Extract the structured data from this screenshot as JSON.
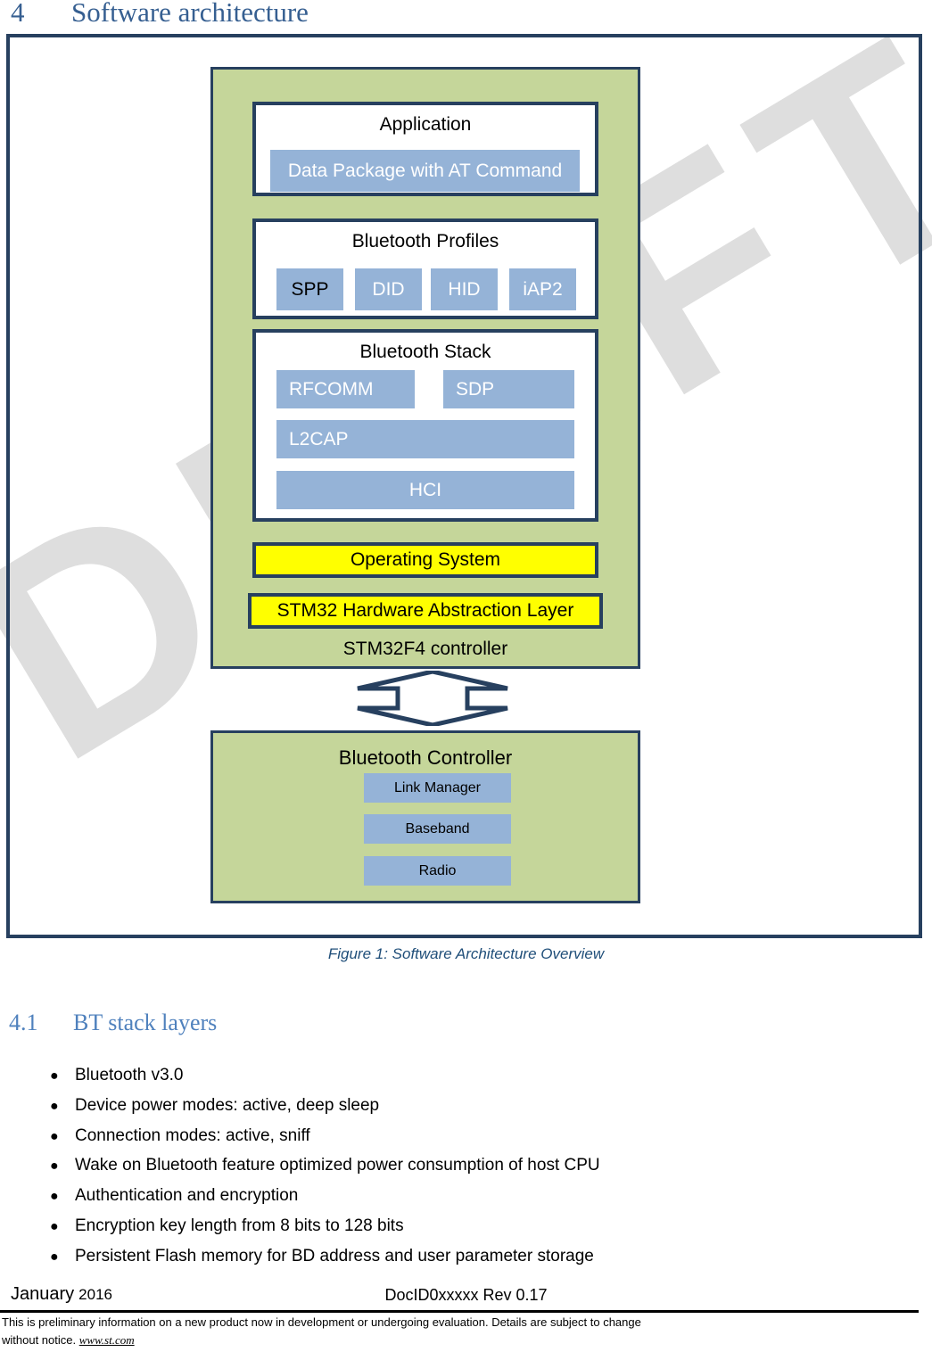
{
  "heading": {
    "number": "4",
    "title": "Software architecture"
  },
  "subheading": {
    "number": "4.1",
    "title": "BT stack layers"
  },
  "watermark": {
    "text": "DRAFT"
  },
  "figure": {
    "caption": "Figure 1: Software Architecture Overview",
    "host": {
      "footer_label": "STM32F4 controller",
      "application": {
        "title": "Application",
        "chip": "Data Package with AT Command"
      },
      "profiles": {
        "title": "Bluetooth Profiles",
        "chips": [
          "SPP",
          "DID",
          "HID",
          "iAP2"
        ]
      },
      "stack": {
        "title": "Bluetooth Stack",
        "rfcomm": "RFCOMM",
        "sdp": "SDP",
        "l2cap": "L2CAP",
        "hci": "HCI"
      },
      "os": "Operating System",
      "hal": "STM32 Hardware Abstraction Layer"
    },
    "controller": {
      "title": "Bluetooth Controller",
      "chips": [
        "Link Manager",
        "Baseband",
        "Radio"
      ]
    },
    "colors": {
      "green": "#c5d69a",
      "navy": "#27405f",
      "blue": "#95b3d7",
      "yellow": "#ffff00",
      "heading_blue": "#365f91",
      "caption_blue": "#1f4e79"
    }
  },
  "bullets": [
    "Bluetooth v3.0",
    "Device power modes: active, deep sleep",
    "Connection modes: active, sniff",
    "Wake on Bluetooth feature optimized power consumption of host CPU",
    "Authentication and encryption",
    "Encryption key length from 8 bits to 128 bits",
    "Persistent Flash memory for BD address and user parameter storage"
  ],
  "footer": {
    "month": "January",
    "year": "2016",
    "docid": "DocID0xxxxx Rev 0.17",
    "note_line1": "This is preliminary information on a new product now in development or undergoing   evaluation.  Details are subject to change",
    "note_line2": "without notice.",
    "link": "www.st.com"
  }
}
